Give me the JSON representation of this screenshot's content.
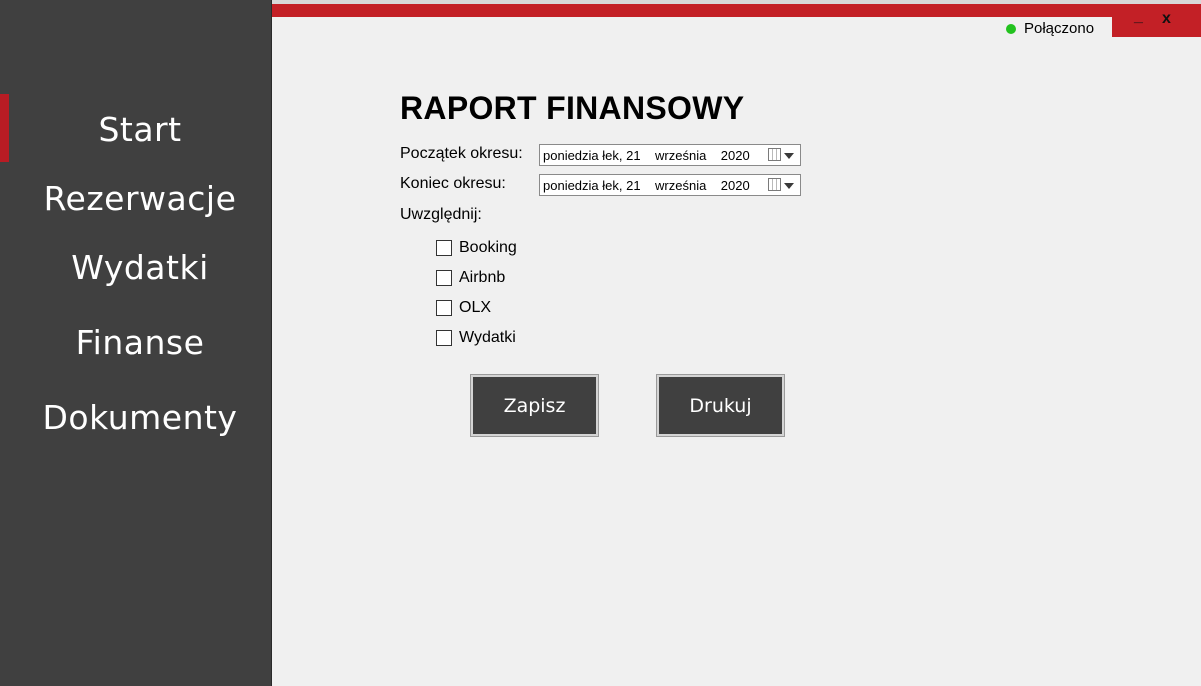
{
  "sidebar": {
    "items": [
      {
        "label": "Start"
      },
      {
        "label": "Rezerwacje"
      },
      {
        "label": "Wydatki"
      },
      {
        "label": "Finanse"
      },
      {
        "label": "Dokumenty"
      }
    ],
    "active_index": 0
  },
  "header": {
    "status_label": "Połączono",
    "minimize_glyph": "_",
    "close_glyph": "x"
  },
  "main": {
    "title": "RAPORT FINANSOWY",
    "start_label": "Początek okresu:",
    "start_date": "poniedzia łek, 21    września    2020",
    "end_label": "Koniec okresu:",
    "end_date": "poniedzia łek, 21    września    2020",
    "include_label": "Uwzględnij:",
    "checkboxes": [
      {
        "label": "Booking",
        "checked": false
      },
      {
        "label": "Airbnb",
        "checked": false
      },
      {
        "label": "OLX",
        "checked": false
      },
      {
        "label": "Wydatki",
        "checked": false
      }
    ],
    "save_label": "Zapisz",
    "print_label": "Drukuj"
  },
  "colors": {
    "accent": "#c32026",
    "sidebar_bg": "#404040",
    "status_ok": "#22c21e"
  }
}
